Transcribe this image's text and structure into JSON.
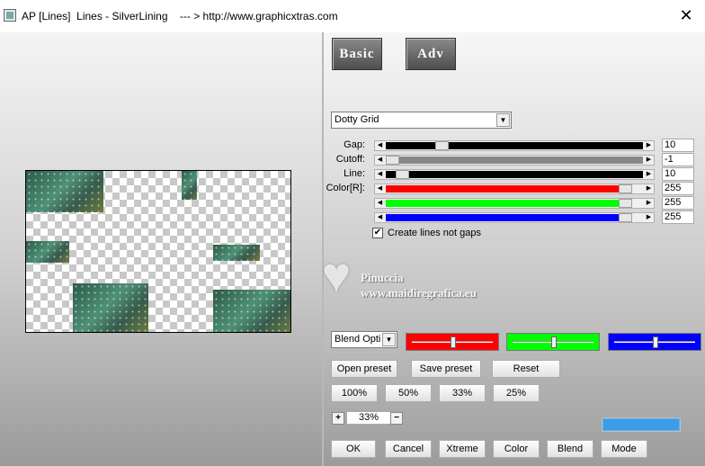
{
  "window": {
    "title": "AP [Lines]  Lines - SilverLining    --- > http://www.graphicxtras.com",
    "close_glyph": "✕"
  },
  "tabs": {
    "basic": "Basic",
    "adv": "Adv"
  },
  "preset_select": {
    "value": "Dotty Grid"
  },
  "sliders": [
    {
      "label": "Gap:",
      "value": "10",
      "color": "#000000",
      "fill": 1.0,
      "thumb": 0.2
    },
    {
      "label": "Cutoff:",
      "value": "-1",
      "color": "#888888",
      "fill": 1.0,
      "thumb": 0.0
    },
    {
      "label": "Line:",
      "value": "10",
      "color": "#000000",
      "fill": 1.0,
      "thumb": 0.04
    },
    {
      "label": "Color[R]:",
      "value": "255",
      "color": "#ff0000",
      "fill": 0.95,
      "thumb": 0.95
    },
    {
      "label": "",
      "value": "255",
      "color": "#00ff00",
      "fill": 0.95,
      "thumb": 0.95
    },
    {
      "label": "",
      "value": "255",
      "color": "#0000ff",
      "fill": 0.95,
      "thumb": 0.95
    }
  ],
  "checkbox": {
    "label": "Create lines not gaps",
    "checked": true,
    "mark": "✔"
  },
  "blend_select": {
    "value": "Blend Opti"
  },
  "color_sliders": [
    {
      "color": "#ff0000",
      "level": 0.5
    },
    {
      "color": "#00ff00",
      "level": 0.5
    },
    {
      "color": "#0000ff",
      "level": 0.5
    }
  ],
  "buttons": {
    "open_preset": "Open preset",
    "save_preset": "Save preset",
    "reset": "Reset",
    "zoom_100": "100%",
    "zoom_50": "50%",
    "zoom_33": "33%",
    "zoom_25": "25%",
    "zoom_plus": "+",
    "zoom_minus": "−",
    "ok": "OK",
    "cancel": "Cancel",
    "xtreme": "Xtreme",
    "color": "Color",
    "blend": "Blend",
    "mode": "Mode"
  },
  "zoom_readout": "33%",
  "accent_color": "#3d9ce8",
  "watermark": {
    "name": "Pinuccia",
    "url": "www.maidiregrafica.eu"
  }
}
